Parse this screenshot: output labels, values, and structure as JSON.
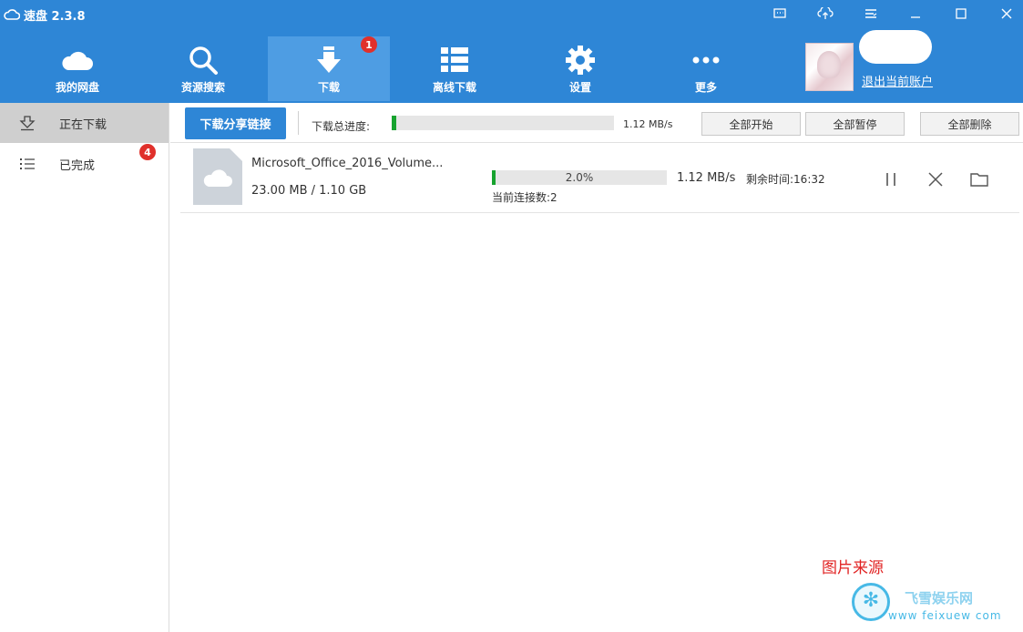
{
  "app": {
    "title": "速盘 2.3.8"
  },
  "nav": {
    "items": [
      {
        "label": "我的网盘",
        "icon": "cloud-icon"
      },
      {
        "label": "资源搜索",
        "icon": "search-icon"
      },
      {
        "label": "下载",
        "icon": "download-icon",
        "badge": "1",
        "active": true
      },
      {
        "label": "离线下载",
        "icon": "list-icon"
      },
      {
        "label": "设置",
        "icon": "gear-icon"
      },
      {
        "label": "更多",
        "icon": "more-icon"
      }
    ]
  },
  "account": {
    "logout_label": "退出当前账户"
  },
  "sidebar": {
    "items": [
      {
        "label": "正在下载",
        "icon": "downloading-icon",
        "active": true
      },
      {
        "label": "已完成",
        "icon": "list-bullets-icon",
        "badge": "4"
      }
    ]
  },
  "toolbar": {
    "share_label": "下载分享链接",
    "total_label": "下载总进度:",
    "total_progress": 0.02,
    "total_speed": "1.12 MB/s",
    "start_all": "全部开始",
    "pause_all": "全部暂停",
    "delete_all": "全部删除"
  },
  "downloads": [
    {
      "name": "Microsoft_Office_2016_Volume...",
      "size": "23.00 MB / 1.10 GB",
      "progress_text": "2.0%",
      "progress": 0.02,
      "speed": "1.12 MB/s",
      "eta": "剩余时间:16:32",
      "connections": "当前连接数:2"
    }
  ],
  "watermark": {
    "caption": "图片来源",
    "site_cn": "飞雪娱乐网",
    "site_en": "www  feixuew  com"
  },
  "colors": {
    "brand": "#2e86d6",
    "progress": "#17a32f",
    "badge": "#e0302b"
  }
}
